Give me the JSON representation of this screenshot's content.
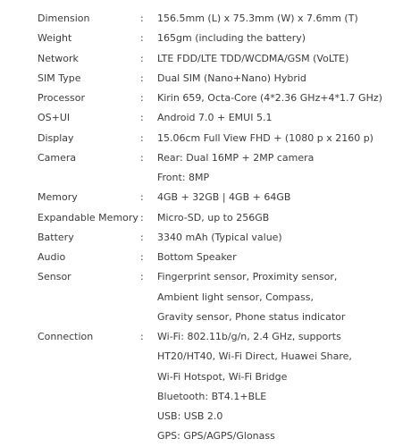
{
  "specs": [
    {
      "label": "Dimension",
      "colon": ":",
      "lines": [
        "156.5mm (L) x 75.3mm (W) x 7.6mm (T)"
      ]
    },
    {
      "label": "Weight",
      "colon": ":",
      "lines": [
        "165gm (including the battery)"
      ]
    },
    {
      "label": "Network",
      "colon": ":",
      "lines": [
        "LTE FDD/LTE TDD/WCDMA/GSM (VoLTE)"
      ]
    },
    {
      "label": "SIM Type",
      "colon": ":",
      "lines": [
        "Dual SIM (Nano+Nano) Hybrid"
      ]
    },
    {
      "label": "Processor",
      "colon": ":",
      "lines": [
        "Kirin 659, Octa-Core (4*2.36 GHz+4*1.7 GHz)"
      ]
    },
    {
      "label": "OS+UI",
      "colon": ":",
      "lines": [
        "Android 7.0 + EMUI 5.1"
      ]
    },
    {
      "label": "Display",
      "colon": ":",
      "lines": [
        "15.06cm Full View FHD + (1080 p x 2160 p)"
      ]
    },
    {
      "label": "Camera",
      "colon": ":",
      "lines": [
        "Rear: Dual 16MP + 2MP camera",
        "Front: 8MP"
      ]
    },
    {
      "label": "Memory",
      "colon": ":",
      "lines": [
        "4GB + 32GB | 4GB + 64GB"
      ]
    },
    {
      "label": "Expandable Memory",
      "colon": ":",
      "lines": [
        "Micro-SD, up to 256GB"
      ]
    },
    {
      "label": "Battery",
      "colon": ":",
      "lines": [
        "3340 mAh (Typical value)"
      ]
    },
    {
      "label": "Audio",
      "colon": ":",
      "lines": [
        "Bottom Speaker"
      ]
    },
    {
      "label": "Sensor",
      "colon": ":",
      "lines": [
        "Fingerprint sensor, Proximity sensor,",
        "Ambient light sensor, Compass,",
        "Gravity sensor, Phone status indicator"
      ]
    },
    {
      "label": "Connection",
      "colon": ":",
      "lines": [
        "Wi-Fi: 802.11b/g/n, 2.4 GHz, supports",
        "HT20/HT40, Wi-Fi Direct, Huawei Share,",
        "Wi-Fi Hotspot, Wi-Fi Bridge",
        "Bluetooth: BT4.1+BLE",
        "USB: USB 2.0",
        "GPS: GPS/AGPS/Glonass"
      ]
    }
  ]
}
